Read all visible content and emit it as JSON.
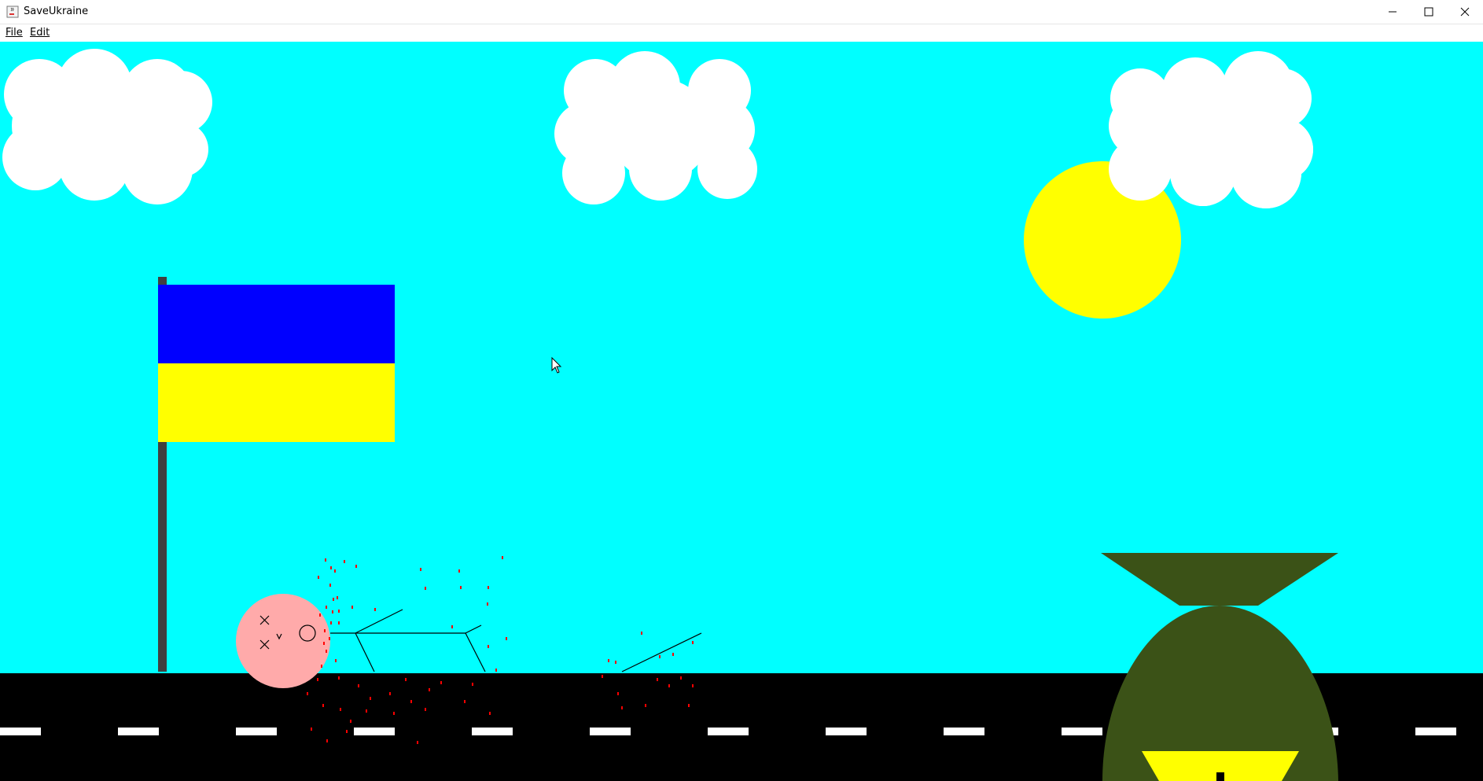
{
  "window": {
    "title": "SaveUkraine"
  },
  "menu": {
    "file": "File",
    "edit": "Edit"
  },
  "icons": {
    "app": "java-cup-icon",
    "minimize": "minimize-icon",
    "maximize": "maximize-icon",
    "close": "close-icon",
    "cursor": "mouse-pointer-icon"
  },
  "colors": {
    "sky": "#00FFFF",
    "road": "#000000",
    "road_dash": "#FFFFFF",
    "cloud": "#FFFFFF",
    "sun": "#FFFF00",
    "flag_top": "#0000FF",
    "flag_bottom": "#FFFF00",
    "flag_pole": "#404040",
    "bomb": "#3B5217",
    "bomb_window": "#FFFF00",
    "head": "#FFAAAA",
    "blood": "#FF0000"
  }
}
